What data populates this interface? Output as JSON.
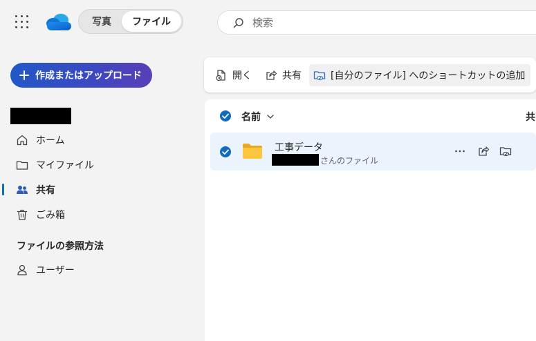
{
  "header": {
    "tabs": [
      {
        "label": "写真",
        "selected": false
      },
      {
        "label": "ファイル",
        "selected": true
      }
    ],
    "search": {
      "placeholder": "検索",
      "value": ""
    }
  },
  "sidebar": {
    "create_label": "作成またはアップロード",
    "items": [
      {
        "label": "ホーム",
        "icon": "home-icon",
        "active": false
      },
      {
        "label": "マイファイル",
        "icon": "folder-icon",
        "active": false
      },
      {
        "label": "共有",
        "icon": "people-icon",
        "active": true
      },
      {
        "label": "ごみ箱",
        "icon": "trash-icon",
        "active": false
      }
    ],
    "section_title": "ファイルの参照方法",
    "section_items": [
      {
        "label": "ユーザー",
        "icon": "person-icon"
      }
    ]
  },
  "commandbar": {
    "open_label": "開く",
    "share_label": "共有",
    "shortcut_label": "[自分のファイル] へのショートカットの追加"
  },
  "list": {
    "columns": {
      "name": "名前",
      "shared": "共"
    },
    "rows": [
      {
        "name": "工事データ",
        "owner_suffix": "さんのファイル",
        "selected": true,
        "icon": "folder-icon"
      }
    ]
  },
  "colors": {
    "accent": "#0f6cbd",
    "create_gradient_start": "#2258c8",
    "create_gradient_end": "#5a3fb8",
    "selected_row": "#ebf3fc",
    "folder": "#f4c430"
  }
}
